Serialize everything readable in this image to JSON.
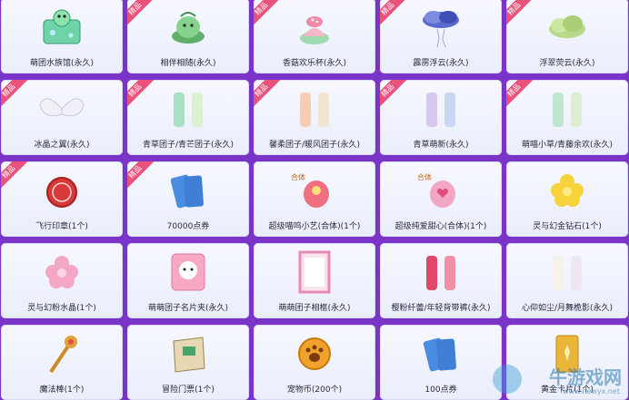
{
  "ribbon_text": "精品",
  "rows": [
    [
      {
        "label": "萌团水族馆(永久)",
        "icon": "aquarium-icon",
        "ribbon": false
      },
      {
        "label": "相伴相随(永久)",
        "icon": "green-blob-icon",
        "ribbon": true
      },
      {
        "label": "香菇欢乐杯(永久)",
        "icon": "mushroom-cup-icon",
        "ribbon": true
      },
      {
        "label": "霹雳浮云(永久)",
        "icon": "thunder-cloud-icon",
        "ribbon": true
      },
      {
        "label": "浮翠荧云(永久)",
        "icon": "green-cloud-icon",
        "ribbon": true
      }
    ],
    [
      {
        "label": "冰晶之翼(永久)",
        "icon": "ice-wings-icon",
        "ribbon": true
      },
      {
        "label": "青草团子/青芒团子(永久)",
        "icon": "green-outfit-icon",
        "ribbon": true
      },
      {
        "label": "馨柔团子/暖风团子(永久)",
        "icon": "peach-outfit-icon",
        "ribbon": true
      },
      {
        "label": "青草萌新(永久)",
        "icon": "lilac-outfit-icon",
        "ribbon": true
      },
      {
        "label": "萌喵小草/青藤余欢(永久)",
        "icon": "mint-outfit-icon",
        "ribbon": true
      }
    ],
    [
      {
        "label": "飞行印章(1个)",
        "icon": "red-stamp-icon",
        "ribbon": true
      },
      {
        "label": "70000点券",
        "icon": "blue-coupon-icon",
        "ribbon": true
      },
      {
        "label": "超级喵呜小艺(合体)(1个)",
        "icon": "pink-egg-icon",
        "ribbon": false,
        "badge": "合体"
      },
      {
        "label": "超级纯爱甜心(合体)(1个)",
        "icon": "pink-heart-egg-icon",
        "ribbon": false,
        "badge": "合体"
      },
      {
        "label": "灵与幻金钻石(1个)",
        "icon": "gold-flower-icon",
        "ribbon": false
      }
    ],
    [
      {
        "label": "灵与幻粉水晶(1个)",
        "icon": "pink-flower-icon",
        "ribbon": false
      },
      {
        "label": "萌萌团子名片夹(永久)",
        "icon": "pink-card-holder-icon",
        "ribbon": false
      },
      {
        "label": "萌萌团子相框(永久)",
        "icon": "photo-frame-icon",
        "ribbon": false
      },
      {
        "label": "樱粉纤蕾/年轻背带裤(永久)",
        "icon": "red-outfit-icon",
        "ribbon": false
      },
      {
        "label": "心仰如尘/月舞桅影(永久)",
        "icon": "white-outfit-icon",
        "ribbon": false
      }
    ],
    [
      {
        "label": "魔法棒(1个)",
        "icon": "magic-wand-icon",
        "ribbon": false
      },
      {
        "label": "冒险门票(1个)",
        "icon": "adventure-ticket-icon",
        "ribbon": false
      },
      {
        "label": "宠物币(200个)",
        "icon": "pet-coin-icon",
        "ribbon": false
      },
      {
        "label": "100点券",
        "icon": "blue-coupon-icon",
        "ribbon": false
      },
      {
        "label": "黄金卡片(1个)",
        "icon": "gold-card-icon",
        "ribbon": false
      }
    ]
  ],
  "watermark": {
    "text": "牛游戏网",
    "url": "www.newyx.net"
  }
}
